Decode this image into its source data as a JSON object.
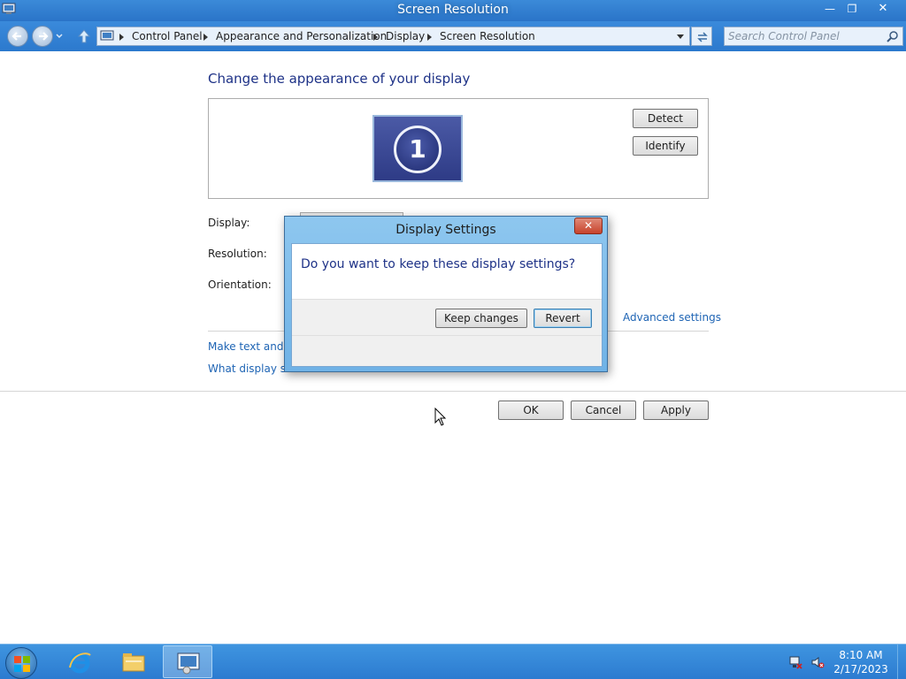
{
  "window": {
    "title": "Screen Resolution",
    "controls": {
      "minimize": "—",
      "maximize": "❐",
      "close": "✕"
    }
  },
  "address_bar": {
    "breadcrumbs": [
      "Control Panel",
      "Appearance and Personalization",
      "Display",
      "Screen Resolution"
    ],
    "search_placeholder": "Search Control Panel"
  },
  "main": {
    "heading": "Change the appearance of your display",
    "monitor_number": "1",
    "detect_label": "Detect",
    "identify_label": "Identify",
    "display_label": "Display:",
    "resolution_label": "Resolution:",
    "orientation_label": "Orientation:",
    "advanced_settings_link": "Advanced settings",
    "make_text_link": "Make text and ot",
    "what_display_link": "What display setti",
    "ok_label": "OK",
    "cancel_label": "Cancel",
    "apply_label": "Apply"
  },
  "dialog": {
    "title": "Display Settings",
    "close": "✕",
    "question": "Do you want to keep these display settings?",
    "keep_label": "Keep changes",
    "revert_label": "Revert"
  },
  "taskbar": {
    "time": "8:10 AM",
    "date": "2/17/2023",
    "pinned": [
      "Internet Explorer",
      "File Explorer",
      "Control Panel"
    ]
  },
  "colors": {
    "title_bar": "#2a74c8",
    "heading_text": "#1e3287",
    "link_text": "#1e64b4",
    "taskbar": "#2c7bd0"
  }
}
